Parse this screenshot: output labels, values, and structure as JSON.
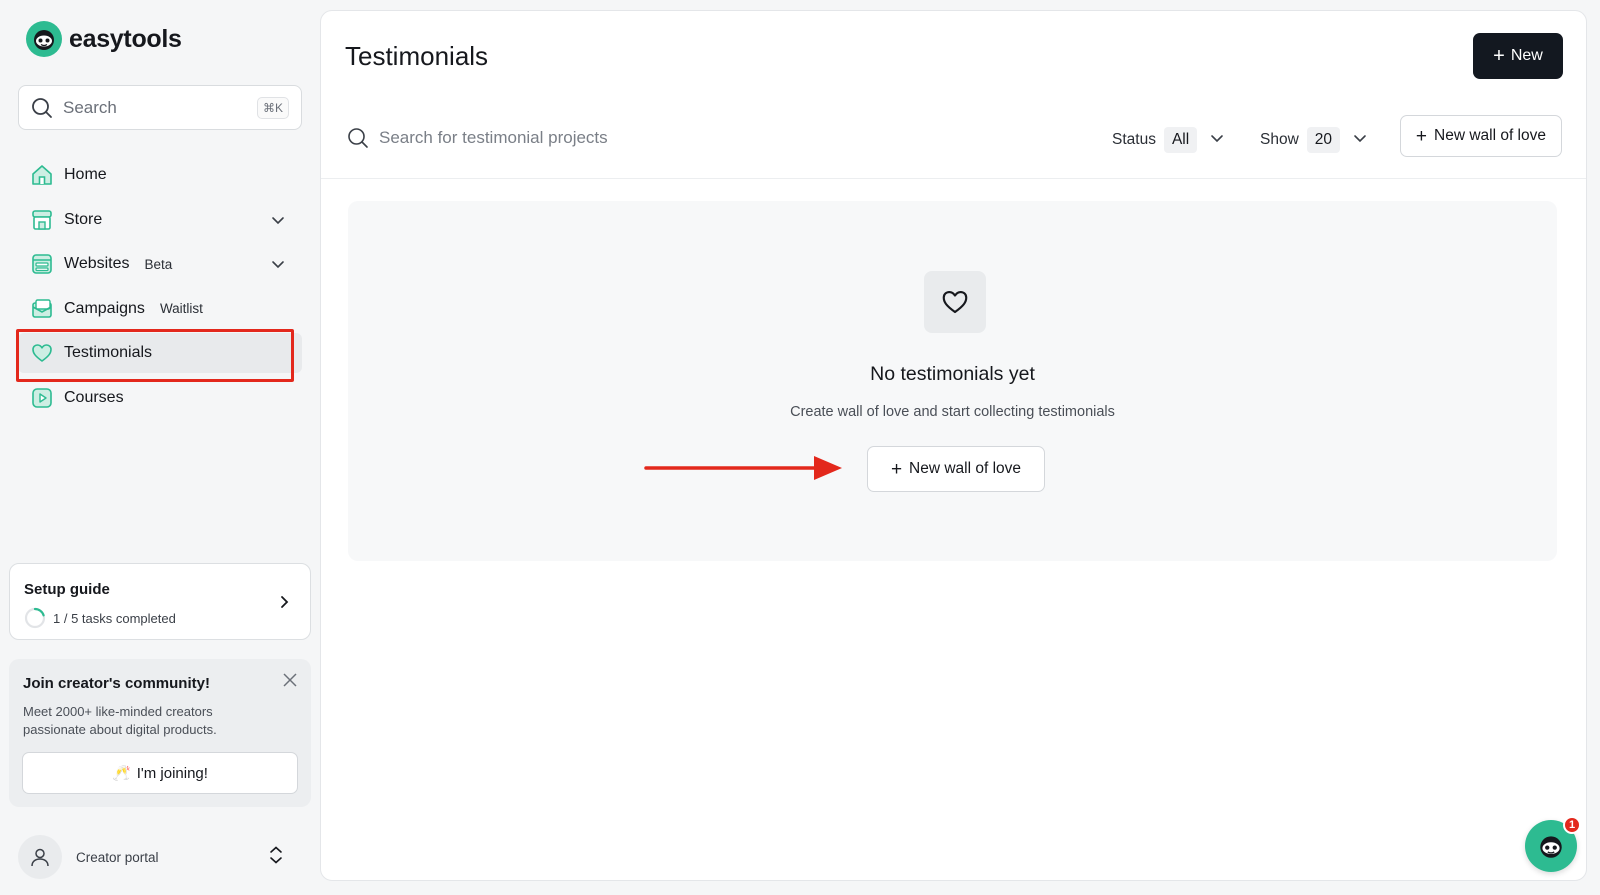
{
  "app": {
    "name": "easytools"
  },
  "sidebar": {
    "search": {
      "placeholder": "Search",
      "shortcut": "⌘K"
    },
    "items": [
      {
        "label": "Home",
        "icon": "home-icon",
        "badge": ""
      },
      {
        "label": "Store",
        "icon": "store-icon",
        "badge": ""
      },
      {
        "label": "Websites",
        "icon": "websites-icon",
        "badge": "Beta"
      },
      {
        "label": "Campaigns",
        "icon": "mail-icon",
        "badge": "Waitlist"
      },
      {
        "label": "Testimonials",
        "icon": "heart-icon",
        "badge": "",
        "active": true
      },
      {
        "label": "Courses",
        "icon": "play-icon",
        "badge": ""
      }
    ],
    "setup_guide": {
      "title": "Setup guide",
      "progress_text": "1 / 5 tasks completed",
      "progress": 0.2
    },
    "community": {
      "title": "Join creator's community!",
      "description": "Meet 2000+ like-minded creators passionate about digital products.",
      "button": "I'm joining!"
    },
    "account": {
      "label": "Creator portal"
    }
  },
  "main": {
    "title": "Testimonials",
    "new_button": "New",
    "search": {
      "placeholder": "Search for testimonial projects"
    },
    "filters": {
      "status_label": "Status",
      "status_value": "All",
      "show_label": "Show",
      "show_value": "20"
    },
    "new_wall_button": "New wall of love",
    "empty": {
      "title": "No testimonials yet",
      "subtitle": "Create wall of love and start collecting testimonials",
      "button": "New wall of love"
    }
  },
  "chat": {
    "badge": "1"
  },
  "colors": {
    "brand": "#2dbb91",
    "primary_button": "#131820",
    "annotation_red": "#e3281c"
  }
}
